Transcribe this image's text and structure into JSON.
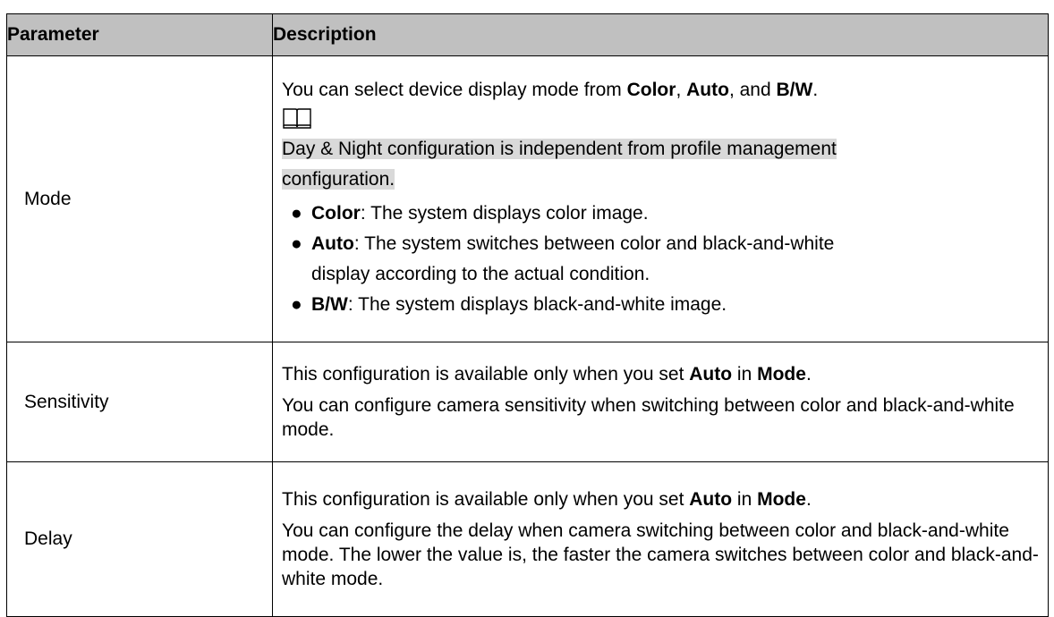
{
  "table": {
    "headers": [
      "Parameter",
      "Description"
    ],
    "rows": {
      "mode": {
        "name": "Mode",
        "intro_prefix": "You can select device display mode from ",
        "opt_color": "Color",
        "sep1": ", ",
        "opt_auto": "Auto",
        "sep2": ", and ",
        "opt_bw": "B/W",
        "end": ".",
        "note_icon": "book-icon",
        "note_line1": "Day & Night configuration is independent from profile management",
        "note_line2": "configuration.",
        "bullets": [
          {
            "term": "Color",
            "text": ": The system displays color image."
          },
          {
            "term": "Auto",
            "text": ": The system switches between color and black-and-white",
            "text2": "display according to the actual condition."
          },
          {
            "term": "B/W",
            "text": ": The system displays black-and-white image."
          }
        ]
      },
      "sensitivity": {
        "name": "Sensitivity",
        "p1_prefix": "This configuration is available only when you set ",
        "p1_b1": "Auto",
        "p1_mid": " in ",
        "p1_b2": "Mode",
        "p1_end": ".",
        "p2": "You can configure camera sensitivity when switching between color and black-and-white mode."
      },
      "delay": {
        "name": "Delay",
        "p1_prefix": "This configuration is available only when you set ",
        "p1_b1": "Auto",
        "p1_mid": " in ",
        "p1_b2": "Mode",
        "p1_end": ".",
        "p2": "You can configure the delay when camera switching between color and black-and-white mode. The lower the value is, the faster the camera switches between color and black-and-white mode."
      }
    }
  }
}
